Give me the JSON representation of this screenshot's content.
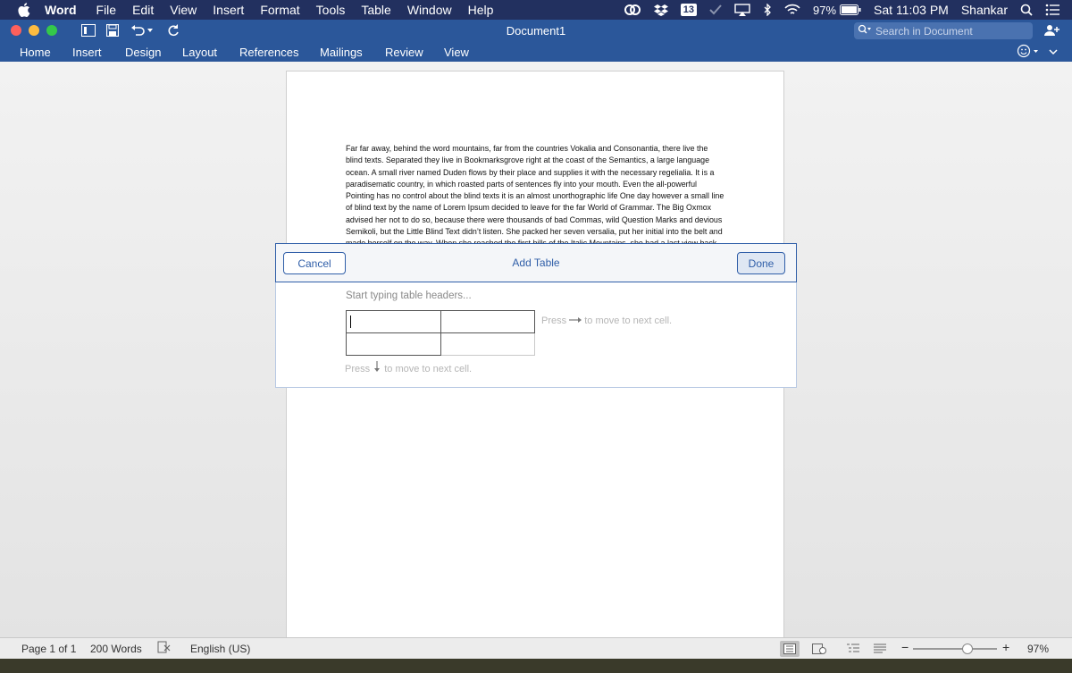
{
  "menubar": {
    "app_name": "Word",
    "items": [
      "File",
      "Edit",
      "View",
      "Insert",
      "Format",
      "Tools",
      "Table",
      "Window",
      "Help"
    ],
    "notification_count": "13",
    "battery": "97%",
    "clock": "Sat 11:03 PM",
    "user": "Shankar"
  },
  "titlebar": {
    "document_title": "Document1",
    "search_placeholder": "Search in Document"
  },
  "ribbon": {
    "tabs": [
      "Home",
      "Insert",
      "Design",
      "Layout",
      "References",
      "Mailings",
      "Review",
      "View"
    ]
  },
  "document": {
    "body_text": "Far far away, behind the word mountains, far from the countries Vokalia and Consonantia, there live the blind texts. Separated they live in Bookmarksgrove right at the coast of the Semantics, a large language ocean. A small river named Duden flows by their place and supplies it with the necessary regelialia. It is a paradisematic country, in which roasted parts of sentences fly into your mouth. Even the all-powerful Pointing has no control about the blind texts it is an almost unorthographic life One day however a small line of blind text by the name of Lorem Ipsum decided to leave for the far World of Grammar. The Big Oxmox advised her not to do so, because there were thousands of bad Commas, wild Question Marks and devious Semikoli, but the Little Blind Text didn’t listen. She packed her seven versalia, put her initial into the belt and made herself on the way. When she reached the first hills of the Italic Mountains, she had a last view back on the skyline of her hometown Bookmarksgrove, the headline of Alphabet Village and the subline of her own road, the Line Lane. Pityful a rethoric question ran over her cheek, then"
  },
  "add_table": {
    "cancel_label": "Cancel",
    "title": "Add Table",
    "done_label": "Done",
    "headers_hint": "Start typing table headers...",
    "right_hint_prefix": "Press",
    "right_hint_suffix": "to move to next cell.",
    "down_hint_prefix": "Press",
    "down_hint_suffix": "to move to next cell."
  },
  "statusbar": {
    "page": "Page 1 of 1",
    "words": "200 Words",
    "language": "English (US)",
    "zoom_label": "97%",
    "zoom_fraction": 0.5
  },
  "colors": {
    "menubar_bg": "#22305f",
    "ribbon_bg": "#2b579a",
    "accent": "#2f5ea8"
  }
}
